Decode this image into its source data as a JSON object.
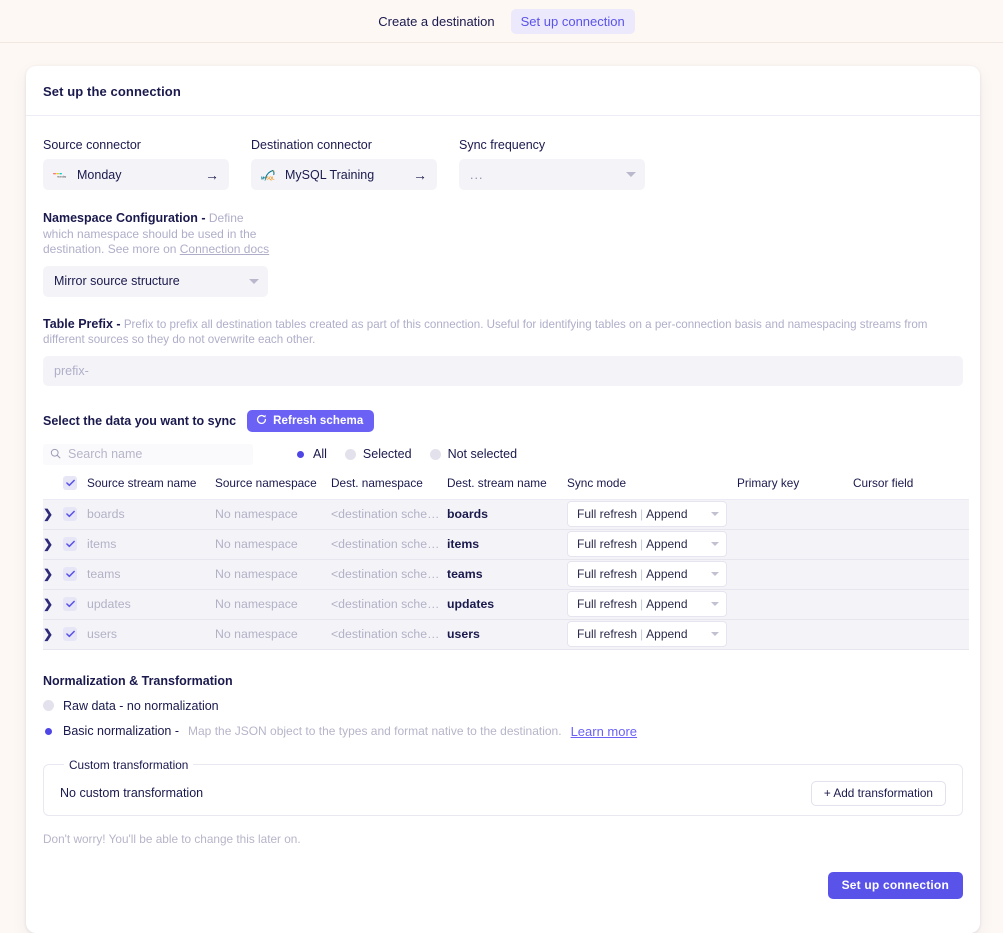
{
  "steps": {
    "create_destination": "Create a destination",
    "setup_connection": "Set up connection"
  },
  "card": {
    "title": "Set up the connection"
  },
  "source_connector": {
    "label": "Source connector",
    "value": "Monday",
    "icon": "monday-logo-icon",
    "arrow": "→"
  },
  "destination_connector": {
    "label": "Destination connector",
    "value": "MySQL Training",
    "icon": "mysql-logo-icon",
    "arrow": "→"
  },
  "sync_frequency": {
    "label": "Sync frequency",
    "value": "...",
    "placeholder": "..."
  },
  "namespace": {
    "title": "Namespace Configuration -",
    "description": "Define which namespace should be used in the destination. See more on",
    "link": "Connection docs",
    "selected": "Mirror source structure"
  },
  "table_prefix": {
    "title": "Table Prefix -",
    "description": "Prefix to prefix all destination tables created as part of this connection. Useful for identifying tables on a per-connection basis and namespacing streams from different sources so they do not overwrite each other.",
    "placeholder": "prefix-",
    "value": ""
  },
  "sync_section": {
    "title": "Select the data you want to sync",
    "refresh_label": "Refresh schema",
    "refresh_icon": "refresh-icon",
    "search_placeholder": "Search name",
    "search_value": "",
    "search_icon": "search-icon",
    "filters": [
      {
        "label": "All",
        "selected": true
      },
      {
        "label": "Selected",
        "selected": false
      },
      {
        "label": "Not selected",
        "selected": false
      }
    ],
    "columns": [
      "Source stream name",
      "Source namespace",
      "Dest. namespace",
      "Dest. stream name",
      "Sync mode",
      "Primary key",
      "Cursor field"
    ],
    "header_checkbox_checked": true,
    "rows": [
      {
        "source_stream_name": "boards",
        "source_namespace": "No namespace",
        "dest_namespace": "<destination schem...",
        "dest_stream_name": "boards",
        "sync_mode_primary": "Full refresh",
        "sync_mode_secondary": "Append",
        "primary_key": "",
        "cursor_field": "",
        "checked": true,
        "expanded": false
      },
      {
        "source_stream_name": "items",
        "source_namespace": "No namespace",
        "dest_namespace": "<destination schem...",
        "dest_stream_name": "items",
        "sync_mode_primary": "Full refresh",
        "sync_mode_secondary": "Append",
        "primary_key": "",
        "cursor_field": "",
        "checked": true,
        "expanded": false
      },
      {
        "source_stream_name": "teams",
        "source_namespace": "No namespace",
        "dest_namespace": "<destination schem...",
        "dest_stream_name": "teams",
        "sync_mode_primary": "Full refresh",
        "sync_mode_secondary": "Append",
        "primary_key": "",
        "cursor_field": "",
        "checked": true,
        "expanded": false
      },
      {
        "source_stream_name": "updates",
        "source_namespace": "No namespace",
        "dest_namespace": "<destination schem...",
        "dest_stream_name": "updates",
        "sync_mode_primary": "Full refresh",
        "sync_mode_secondary": "Append",
        "primary_key": "",
        "cursor_field": "",
        "checked": true,
        "expanded": false
      },
      {
        "source_stream_name": "users",
        "source_namespace": "No namespace",
        "dest_namespace": "<destination schem...",
        "dest_stream_name": "users",
        "sync_mode_primary": "Full refresh",
        "sync_mode_secondary": "Append",
        "primary_key": "",
        "cursor_field": "",
        "checked": true,
        "expanded": false
      }
    ]
  },
  "normalization": {
    "title": "Normalization & Transformation",
    "options": [
      {
        "label": "Raw data - no normalization",
        "description": "",
        "link": "",
        "selected": false
      },
      {
        "label": "Basic normalization -",
        "description": "Map the JSON object to the types and format native to the destination.",
        "link": "Learn more",
        "selected": true
      }
    ]
  },
  "custom_transformation": {
    "legend": "Custom transformation",
    "empty_text": "No custom transformation",
    "add_label": "+ Add transformation"
  },
  "note": "Don't worry! You'll be able to change this later on.",
  "footer": {
    "submit_label": "Set up connection"
  },
  "colors": {
    "accent": "#6b62f5",
    "primary_button": "#5a53ea",
    "page_background": "#fdf8f4",
    "card_background": "#ffffff",
    "field_background": "#f4f4f8",
    "muted_text": "#afaec9",
    "text": "#1a194d"
  }
}
